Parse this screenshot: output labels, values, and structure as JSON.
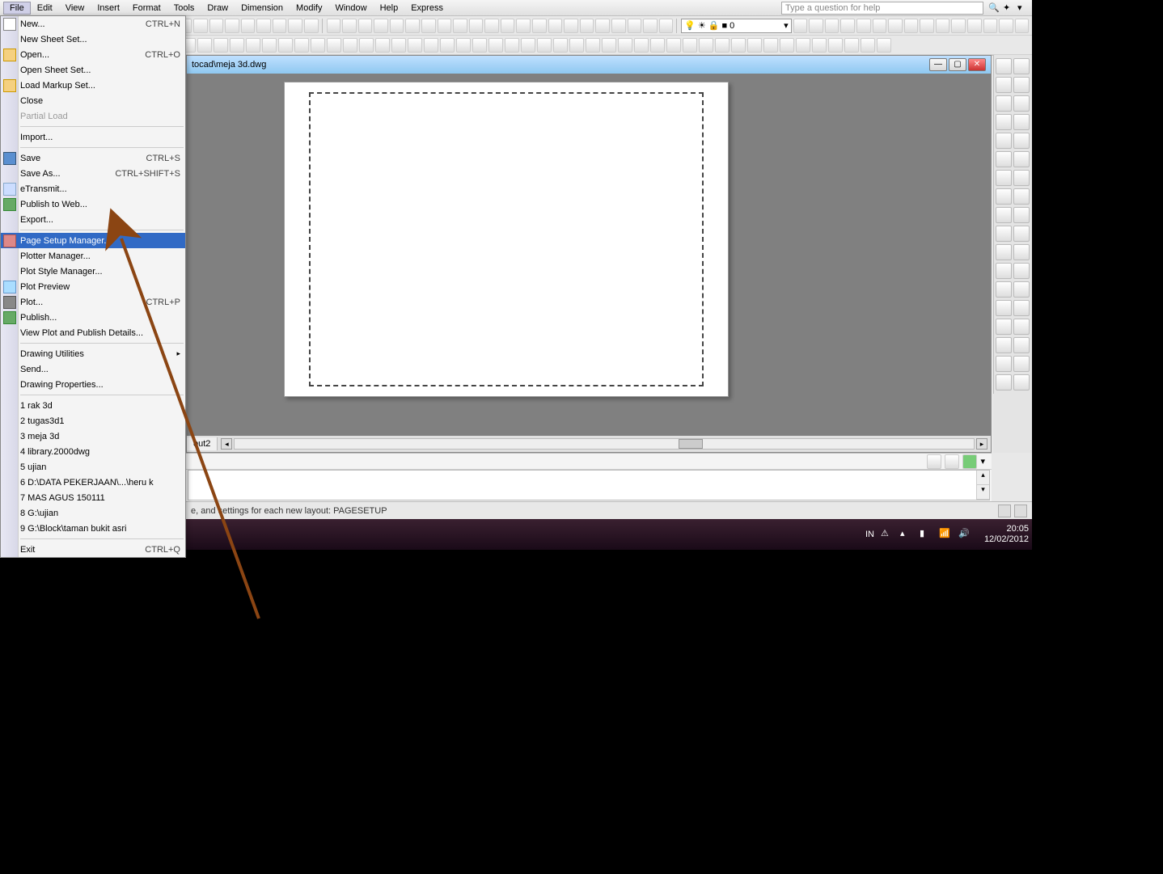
{
  "menubar": {
    "items": [
      "File",
      "Edit",
      "View",
      "Insert",
      "Format",
      "Tools",
      "Draw",
      "Dimension",
      "Modify",
      "Window",
      "Help",
      "Express"
    ],
    "active": "File",
    "help_placeholder": "Type a question for help"
  },
  "layer_combo": {
    "color": "■",
    "value": "0"
  },
  "document": {
    "title": "tocad\\meja 3d.dwg",
    "tab": "out2"
  },
  "file_menu": {
    "groups": [
      [
        {
          "icon": "ico-new",
          "label": "New...",
          "shortcut": "CTRL+N"
        },
        {
          "label": "New Sheet Set..."
        },
        {
          "icon": "ico-open",
          "label": "Open...",
          "shortcut": "CTRL+O"
        },
        {
          "label": "Open Sheet Set..."
        },
        {
          "icon": "ico-open",
          "label": "Load Markup Set..."
        },
        {
          "label": "Close"
        },
        {
          "label": "Partial Load",
          "disabled": true
        }
      ],
      [
        {
          "label": "Import..."
        }
      ],
      [
        {
          "icon": "ico-save",
          "label": "Save",
          "shortcut": "CTRL+S"
        },
        {
          "label": "Save As...",
          "shortcut": "CTRL+SHIFT+S"
        },
        {
          "icon": "ico-etrans",
          "label": "eTransmit..."
        },
        {
          "icon": "ico-pub",
          "label": "Publish to Web..."
        },
        {
          "label": "Export..."
        }
      ],
      [
        {
          "icon": "ico-page",
          "label": "Page Setup Manager...",
          "highlighted": true
        },
        {
          "label": "Plotter Manager..."
        },
        {
          "label": "Plot Style Manager..."
        },
        {
          "icon": "ico-prev",
          "label": "Plot Preview"
        },
        {
          "icon": "ico-plot",
          "label": "Plot...",
          "shortcut": "CTRL+P"
        },
        {
          "icon": "ico-pub",
          "label": "Publish..."
        },
        {
          "label": "View Plot and Publish Details..."
        }
      ],
      [
        {
          "label": "Drawing Utilities",
          "submenu": true
        },
        {
          "label": "Send..."
        },
        {
          "label": "Drawing Properties..."
        }
      ],
      [
        {
          "label": "1 rak 3d"
        },
        {
          "label": "2 tugas3d1"
        },
        {
          "label": "3 meja 3d"
        },
        {
          "label": "4 library.2000dwg"
        },
        {
          "label": "5 ujian"
        },
        {
          "label": "6 D:\\DATA PEKERJAAN\\...\\heru k"
        },
        {
          "label": "7 MAS AGUS 150111"
        },
        {
          "label": "8 G:\\ujian"
        },
        {
          "label": "9 G:\\Block\\taman bukit asri"
        }
      ],
      [
        {
          "label": "Exit",
          "shortcut": "CTRL+Q"
        }
      ]
    ]
  },
  "status": {
    "text": "e, and settings for each new layout:  PAGESETUP"
  },
  "taskbar": {
    "lang": "IN",
    "time": "20:05",
    "date": "12/02/2012"
  }
}
